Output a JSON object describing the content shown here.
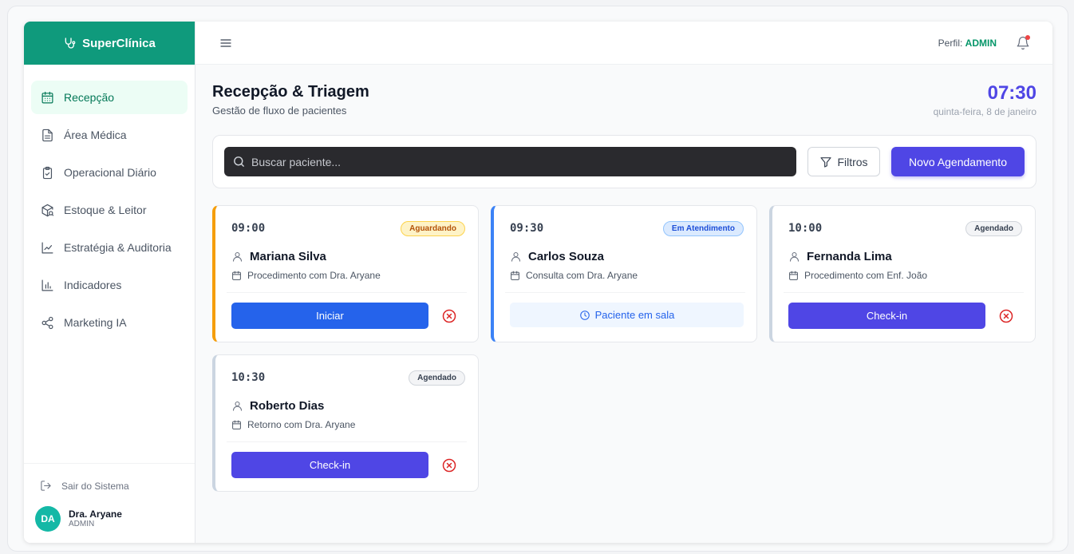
{
  "app": {
    "brand": "SuperClínica"
  },
  "sidebar": {
    "items": [
      {
        "label": "Recepção",
        "icon": "calendar-icon",
        "active": true
      },
      {
        "label": "Área Médica",
        "icon": "document-icon",
        "active": false
      },
      {
        "label": "Operacional Diário",
        "icon": "clipboard-check-icon",
        "active": false
      },
      {
        "label": "Estoque & Leitor",
        "icon": "package-scan-icon",
        "active": false
      },
      {
        "label": "Estratégia & Auditoria",
        "icon": "trend-line-icon",
        "active": false
      },
      {
        "label": "Indicadores",
        "icon": "bar-chart-icon",
        "active": false
      },
      {
        "label": "Marketing IA",
        "icon": "share-icon",
        "active": false
      }
    ],
    "logout_label": "Sair do Sistema",
    "user": {
      "initials": "DA",
      "name": "Dra. Aryane",
      "role": "ADMIN"
    }
  },
  "topbar": {
    "profile_label": "Perfil:",
    "profile_value": "ADMIN"
  },
  "page": {
    "title": "Recepção & Triagem",
    "subtitle": "Gestão de fluxo de pacientes",
    "clock_time": "07:30",
    "clock_date": "quinta-feira, 8 de janeiro"
  },
  "search": {
    "placeholder": "Buscar paciente...",
    "filter_label": "Filtros",
    "new_label": "Novo Agendamento"
  },
  "appointments": [
    {
      "time": "09:00",
      "status": "Aguardando",
      "name": "Mariana Silva",
      "procedure": "Procedimento com Dra. Aryane",
      "action": "Iniciar"
    },
    {
      "time": "09:30",
      "status": "Em Atendimento",
      "name": "Carlos Souza",
      "procedure": "Consulta com Dra. Aryane",
      "action": "Paciente em sala"
    },
    {
      "time": "10:00",
      "status": "Agendado",
      "name": "Fernanda Lima",
      "procedure": "Procedimento com Enf. João",
      "action": "Check-in"
    },
    {
      "time": "10:30",
      "status": "Agendado",
      "name": "Roberto Dias",
      "procedure": "Retorno com Dra. Aryane",
      "action": "Check-in"
    }
  ],
  "colors": {
    "brand": "#0f9a7c",
    "accent": "#4f46e5",
    "waiting": "#f59e0b",
    "attending": "#3b82f6",
    "danger": "#dc2626"
  }
}
